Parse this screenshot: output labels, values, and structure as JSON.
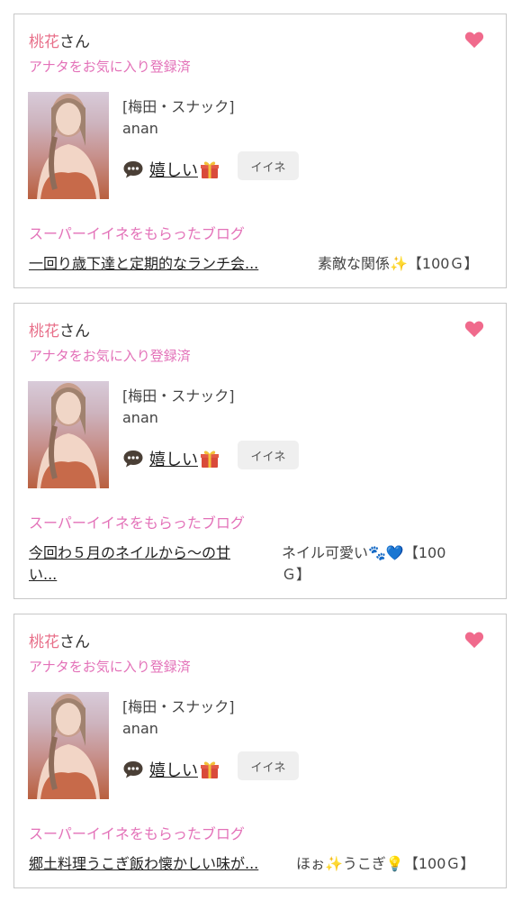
{
  "cards": [
    {
      "user_name": "桃花",
      "user_suffix": "さん",
      "fav_status": "アナタをお気に入り登録済",
      "shop": "[梅田・スナック]",
      "cast": "anan",
      "reaction_text": "嬉しい",
      "iine_label": "イイネ",
      "blog_section_title": "スーパーイイネをもらったブログ",
      "blog_link": "一回り歳下達と定期的なランチ会...",
      "blog_meta_lines": [
        "素敵な関係✨【100Ｇ】"
      ]
    },
    {
      "user_name": "桃花",
      "user_suffix": "さん",
      "fav_status": "アナタをお気に入り登録済",
      "shop": "[梅田・スナック]",
      "cast": "anan",
      "reaction_text": "嬉しい",
      "iine_label": "イイネ",
      "blog_section_title": "スーパーイイネをもらったブログ",
      "blog_link_lines": [
        "今回わ５月のネイルから〜の甘",
        "い..."
      ],
      "blog_meta_lines": [
        "ネイル可愛い🐾💙【100",
        "Ｇ】"
      ]
    },
    {
      "user_name": "桃花",
      "user_suffix": "さん",
      "fav_status": "アナタをお気に入り登録済",
      "shop": "[梅田・スナック]",
      "cast": "anan",
      "reaction_text": "嬉しい",
      "iine_label": "イイネ",
      "blog_section_title": "スーパーイイネをもらったブログ",
      "blog_link": "郷土料理うこぎ飯わ懐かしい味が...",
      "blog_meta_lines": [
        "ほぉ✨うこぎ💡【100Ｇ】"
      ]
    }
  ],
  "colors": {
    "name_accent": "#e8708a",
    "pink_text": "#e371b8",
    "heart": "#f06a8c",
    "iine_bg": "#efefef"
  },
  "icons": [
    "heart-icon",
    "speech-bubble-icon",
    "gift-icon"
  ]
}
